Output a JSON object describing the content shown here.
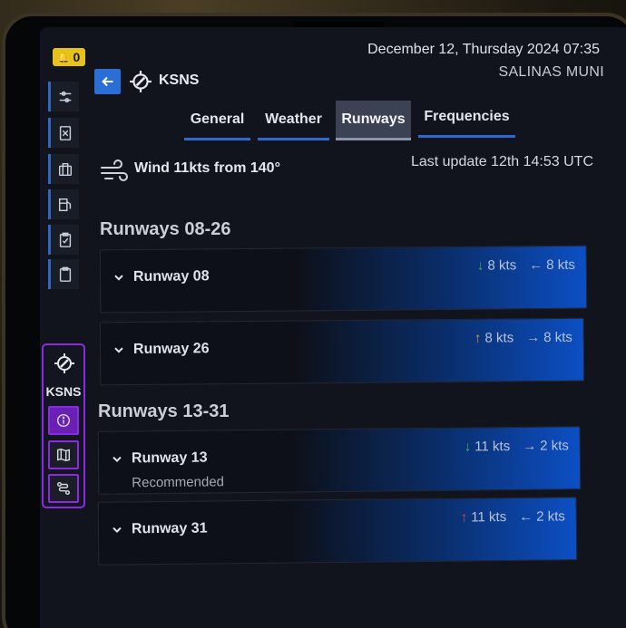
{
  "status": {
    "notification_count": "0",
    "datetime": "December 12, Thursday 2024 07:35",
    "airport_name": "SALINAS MUNI"
  },
  "header": {
    "title": "KSNS"
  },
  "sidebar": {
    "items": [
      {
        "icon": "sliders-icon"
      },
      {
        "icon": "calculator-icon"
      },
      {
        "icon": "briefcase-icon"
      },
      {
        "icon": "fuel-icon"
      },
      {
        "icon": "checklist-icon"
      },
      {
        "icon": "clipboard-icon"
      }
    ],
    "airport_panel": {
      "label": "KSNS",
      "buttons": [
        {
          "icon": "info-icon",
          "active": true
        },
        {
          "icon": "map-icon",
          "active": false
        },
        {
          "icon": "route-icon",
          "active": false
        }
      ]
    }
  },
  "tabs": [
    {
      "label": "General"
    },
    {
      "label": "Weather"
    },
    {
      "label": "Runways"
    },
    {
      "label": "Frequencies"
    }
  ],
  "wind": {
    "text": "Wind 11kts from 140°",
    "last_update": "Last update 12th 14:53 UTC"
  },
  "groups": [
    {
      "title": "Runways 08-26",
      "runways": [
        {
          "name": "Runway 08",
          "subtitle": "",
          "headwind_arrow": "↓",
          "headwind": "8 kts",
          "headwind_color": "#4caf50",
          "cross_arrow": "←",
          "cross": "8 kts"
        },
        {
          "name": "Runway 26",
          "subtitle": "",
          "headwind_arrow": "↑",
          "headwind": "8 kts",
          "headwind_color": "#e0a020",
          "cross_arrow": "→",
          "cross": "8 kts"
        }
      ]
    },
    {
      "title": "Runways 13-31",
      "runways": [
        {
          "name": "Runway 13",
          "subtitle": "Recommended",
          "headwind_arrow": "↓",
          "headwind": "11 kts",
          "headwind_color": "#4caf50",
          "cross_arrow": "→",
          "cross": "2 kts"
        },
        {
          "name": "Runway 31",
          "subtitle": "",
          "headwind_arrow": "↑",
          "headwind": "11 kts",
          "headwind_color": "#e0443a",
          "cross_arrow": "←",
          "cross": "2 kts"
        }
      ]
    }
  ],
  "colors": {
    "accent": "#2c69d1",
    "airport_panel": "#8a2be2",
    "notification": "#e6c21a"
  }
}
